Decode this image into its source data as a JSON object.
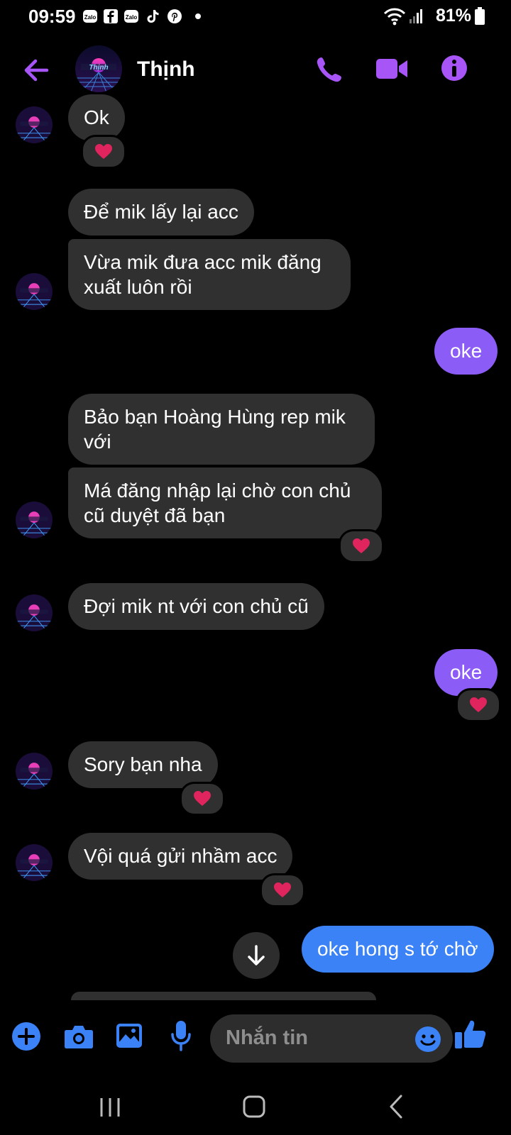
{
  "status_bar": {
    "time": "09:59",
    "battery": "81%",
    "notification_icons": [
      "zalo-icon",
      "facebook-icon",
      "zalo-icon",
      "tiktok-icon",
      "pinterest-icon",
      "dot-icon"
    ]
  },
  "header": {
    "contact_name": "Thịnh",
    "accent_color": "#a855f7"
  },
  "messages": [
    {
      "sender": "them",
      "text": "Ok",
      "reaction": "heart"
    },
    {
      "sender": "them",
      "text": "Để mik lấy lại acc"
    },
    {
      "sender": "them",
      "text": "Vừa mik đưa acc mik đăng xuất luôn rồi"
    },
    {
      "sender": "me",
      "text": "oke"
    },
    {
      "sender": "them",
      "text": "Bảo bạn Hoàng Hùng rep mik với"
    },
    {
      "sender": "them",
      "text": "Má đăng nhập lại chờ con chủ cũ duyệt đã bạn",
      "reaction": "heart"
    },
    {
      "sender": "them",
      "text": "Đợi mik nt với con chủ cũ"
    },
    {
      "sender": "me",
      "text": "oke",
      "reaction": "heart"
    },
    {
      "sender": "them",
      "text": "Sory bạn nha",
      "reaction": "heart"
    },
    {
      "sender": "them",
      "text": "Vội quá gửi nhầm acc",
      "reaction": "heart"
    },
    {
      "sender": "me",
      "text": "oke hong s tớ chờ"
    }
  ],
  "composer": {
    "placeholder": "Nhắn tin"
  },
  "colors": {
    "my_bubble": "#8b5cf6",
    "my_bubble_latest": "#3b82f6",
    "their_bubble": "#303030",
    "composer_icons": "#3b82f6",
    "reaction_heart": "#e0245e"
  }
}
